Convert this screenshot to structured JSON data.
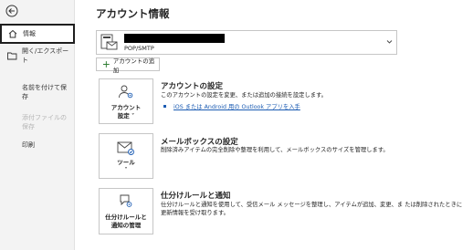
{
  "sidebar": {
    "back_icon": "back-arrow-icon",
    "items": [
      {
        "label": "情報",
        "icon": "home-icon"
      },
      {
        "label": "開く/エクスポート",
        "icon": "folder-open-icon"
      },
      {
        "label": "名前を付けて保存"
      },
      {
        "label": "添付ファイルの保存",
        "disabled": true
      },
      {
        "label": "印刷"
      }
    ]
  },
  "main": {
    "title": "アカウント情報",
    "account": {
      "type": "POP/SMTP",
      "icon": "mail-account-icon"
    },
    "add_account_label": "アカウントの追加",
    "sections": [
      {
        "tile_label": "アカウント 設定 ˅",
        "tile_line1": "アカウント",
        "tile_line2": "設定 ˅",
        "title": "アカウントの設定",
        "description": "このアカウントの設定を変更、または追加の接続を設定します。",
        "link": "iOS または Android 用の Outlook アプリを入手"
      },
      {
        "tile_line1": "ツール",
        "tile_line2": "˅",
        "title": "メールボックスの設定",
        "description": "削除済みアイテムの完全削除や整理を利用して、メールボックスのサイズを管理します。"
      },
      {
        "tile_line1": "仕分けルールと",
        "tile_line2": "通知の管理",
        "title": "仕分けルールと通知",
        "description": "仕分けルールと通知を使用して、受信メール メッセージを整理し、アイテムが追加、変更、ま たは削除されたときに更新情報を受け取ります。"
      }
    ]
  },
  "colors": {
    "sidebar_bg": "#f3f3f3",
    "link": "#1c5cb3",
    "disabled_text": "#b5b5b5"
  }
}
